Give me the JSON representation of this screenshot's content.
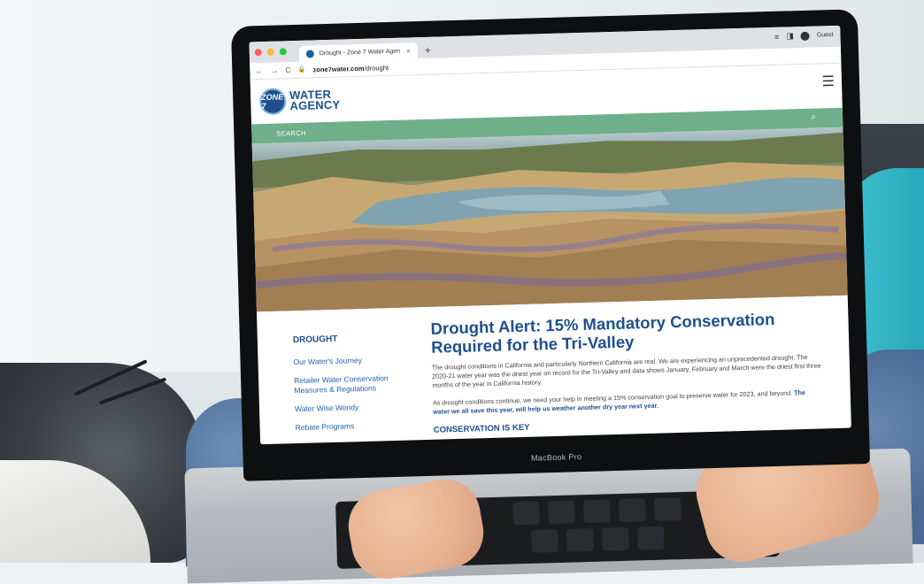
{
  "browser": {
    "tab_title": "Drought - Zone 7 Water Agen",
    "tab_close": "×",
    "new_tab": "+",
    "url_prefix": "zone7water.com",
    "url_path": "/drought",
    "guest_label": "Guest"
  },
  "site": {
    "logo_badge": "ZONE 7",
    "logo_line1": "WATER",
    "logo_line2": "AGENCY",
    "search_label": "SEARCH"
  },
  "sidebar": {
    "title": "DROUGHT",
    "links": [
      "Our Water's Journey",
      "Retailer Water Conservation Measures & Regulations",
      "Water Wise Wendy",
      "Rebate Programs"
    ]
  },
  "main": {
    "headline": "Drought Alert: 15% Mandatory Conservation Required for the Tri-Valley",
    "para1": "The drought conditions in California and particularly Northern California are real. We are experiencing an unprecedented drought. The 2020-21 water year was the driest year on record for the Tri-Valley and data shows January, February and March were the driest first three months of the year in California history.",
    "para2_plain": "As drought conditions continue, we need your help in meeting a 15% conservation goal to preserve water for 2023, and beyond.",
    "para2_bold": "The water we all save this year, will help us weather another dry year next year.",
    "subhead": "CONSERVATION IS KEY"
  },
  "device": {
    "label": "MacBook Pro"
  },
  "colors": {
    "brand_blue": "#1f4f8f",
    "search_green": "#6fb08a"
  }
}
